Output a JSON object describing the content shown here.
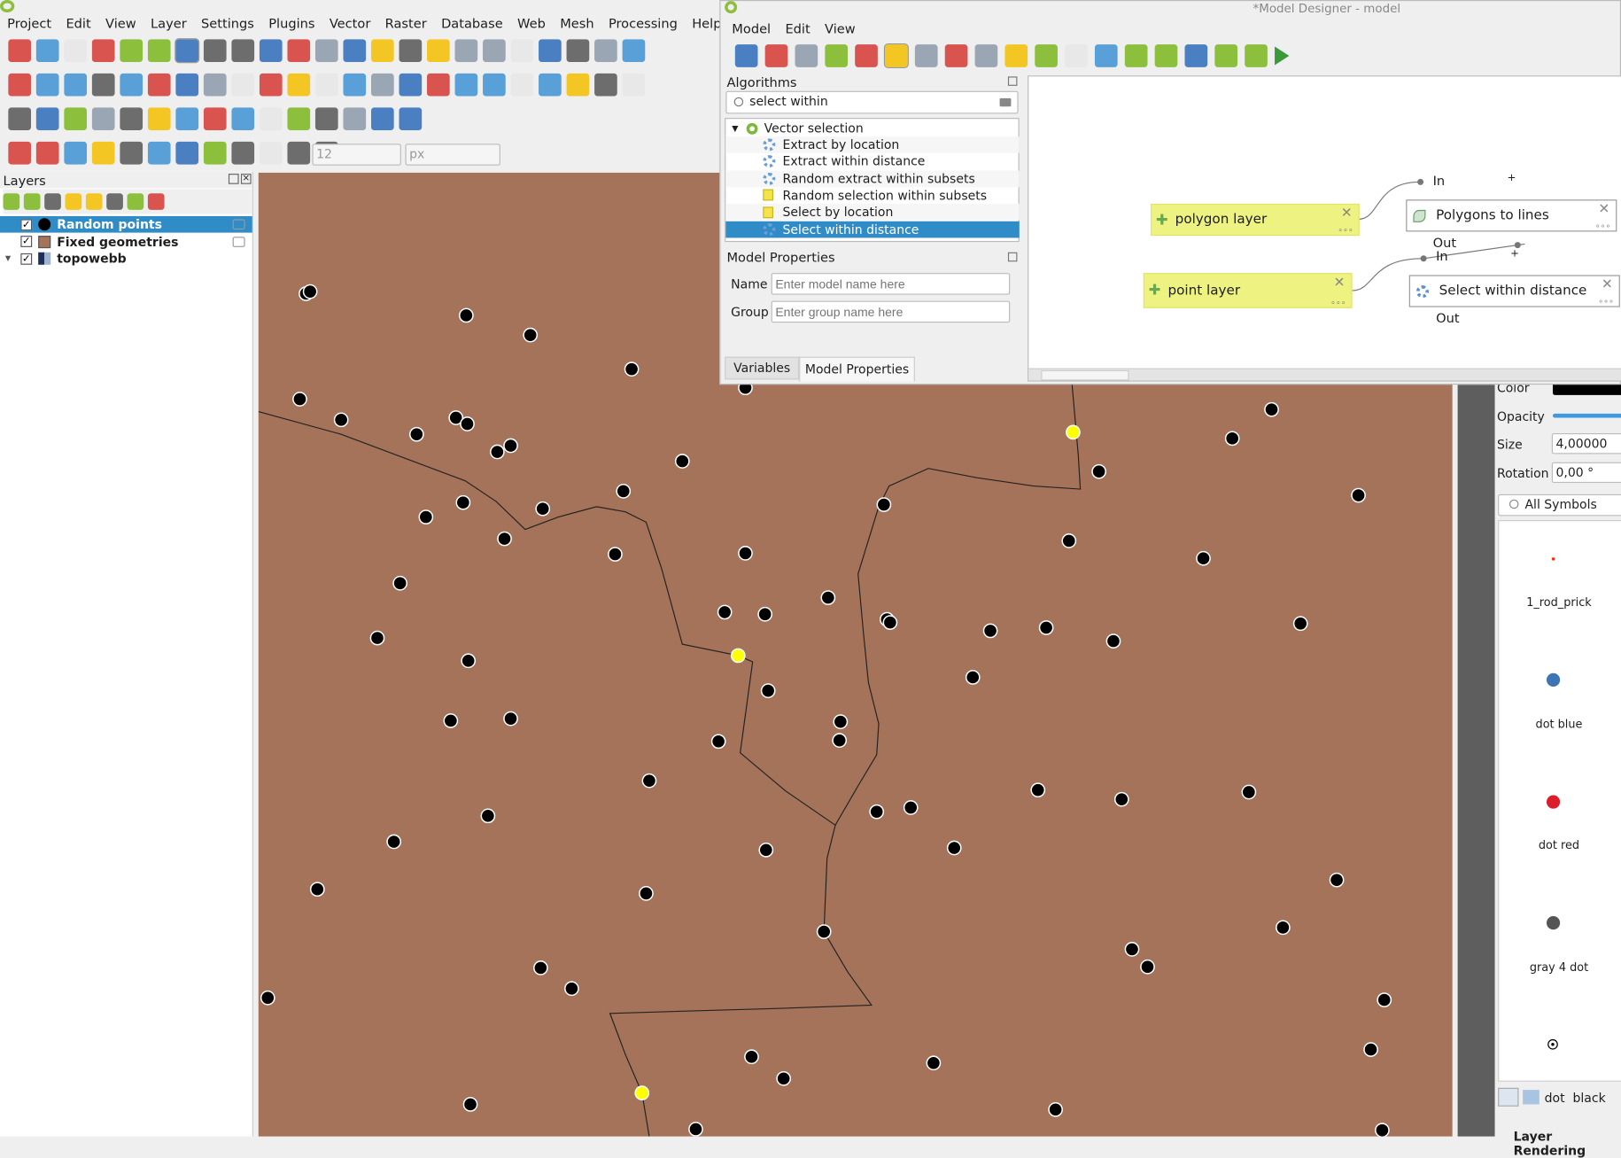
{
  "main": {
    "menu": [
      "Project",
      "Edit",
      "View",
      "Layer",
      "Settings",
      "Plugins",
      "Vector",
      "Raster",
      "Database",
      "Web",
      "Mesh",
      "Processing",
      "Help"
    ],
    "toolbar1": [
      "new-project",
      "open-project",
      "save-project",
      "new-print-layout",
      "layout-manager",
      "style-manager",
      "pan",
      "pan-to-selection",
      "zoom-in",
      "zoom-out",
      "zoom-full",
      "zoom-to-selection",
      "zoom-to-layer",
      "zoom-native",
      "zoom-last",
      "zoom-next",
      "new-map-view",
      "new-3d-view",
      "new-bookmark",
      "show-bookmarks",
      "temporal-controller",
      "refresh",
      "select-features"
    ],
    "toolbar2": [
      "data-source-manager",
      "new-geopackage-layer",
      "new-shapefile-layer",
      "new-spatialite-layer",
      "new-virtual-layer",
      "new-mesh-layer",
      "new-temporary-layer",
      "edits",
      "toggle-editing",
      "save-edits",
      "digitize-point",
      "vertex-tool",
      "modify-attributes",
      "delete-selected",
      "cut",
      "copy",
      "paste",
      "undo",
      "redo",
      "label-tool",
      "diagram-tool",
      "pin-labels",
      "highlight-labels"
    ],
    "toolbar3": [
      "measure",
      "add-ring",
      "add-part",
      "fill-ring",
      "delete-ring",
      "delete-part",
      "reshape",
      "offset-curve",
      "split",
      "merge",
      "merge-attributes",
      "rotate-point",
      "simplify",
      "reverse-line",
      "trim-extend"
    ],
    "toolbar4": [
      "add-circular-string",
      "add-circle",
      "add-ellipse",
      "add-rectangle",
      "add-polygon",
      "snapping",
      "topological-editing",
      "snap-vertex",
      "tracing",
      "self-snapping",
      "avoid-overlap",
      "intersection"
    ],
    "snap_tolerance": "12",
    "snap_unit": "px",
    "layers_panel": {
      "title": "Layers",
      "tools": [
        "open-layer-styling",
        "add-group",
        "manage-themes",
        "filter-legend",
        "filter-by-expression",
        "expand-all",
        "collapse-all",
        "remove-layer"
      ],
      "items": [
        {
          "label": "Random points",
          "checked": true,
          "selected": true,
          "symbol": "black-dot"
        },
        {
          "label": "Fixed geometries",
          "checked": true,
          "selected": false,
          "symbol": "brown-fill"
        },
        {
          "label": "topowebb",
          "checked": true,
          "selected": false,
          "symbol": "raster"
        }
      ]
    },
    "map": {
      "fill_color": "#a57359",
      "point_color": "#000000",
      "selected_point_color": "#ffff00"
    },
    "styling": {
      "color_label": "Color",
      "opacity_label": "Opacity",
      "size_label": "Size",
      "size_value": "4,00000",
      "rotation_label": "Rotation",
      "rotation_value": "0,00 °",
      "search_placeholder": "All Symbols",
      "symbols": [
        {
          "label": "1_rod_prick",
          "color": "#ff2a00"
        },
        {
          "label": "dot blue",
          "color": "#3d74b4"
        },
        {
          "label": "dot red",
          "color": "#db1e2a"
        },
        {
          "label": "gray 4 dot",
          "color": "#555555"
        },
        {
          "label": "",
          "color": "#000000"
        }
      ],
      "selected_symbol": "dot  black",
      "section": "Layer Rendering"
    }
  },
  "designer": {
    "title": "*Model Designer - model",
    "menu": [
      "Model",
      "Edit",
      "View"
    ],
    "toolbar": [
      "new-model",
      "open-model",
      "save-model",
      "save-as",
      "save-in-project",
      "pan",
      "select",
      "undo",
      "redo",
      "zoom-in",
      "zoom-out",
      "zoom-actual",
      "zoom-full",
      "export-python",
      "export-image",
      "export-pdf",
      "export-svg",
      "edit-help",
      "run-model"
    ],
    "algorithms": {
      "title": "Algorithms",
      "search": "select within",
      "group": "Vector selection",
      "items": [
        {
          "label": "Extract by location",
          "icon": "gear"
        },
        {
          "label": "Extract within distance",
          "icon": "gear"
        },
        {
          "label": "Random extract within subsets",
          "icon": "gear"
        },
        {
          "label": "Random selection within subsets",
          "icon": "selection"
        },
        {
          "label": "Select by location",
          "icon": "selection"
        },
        {
          "label": "Select within distance",
          "icon": "gear",
          "selected": true
        }
      ]
    },
    "properties": {
      "title": "Model Properties",
      "name_label": "Name",
      "name_placeholder": "Enter model name here",
      "group_label": "Group",
      "group_placeholder": "Enter group name here"
    },
    "tabs": [
      "Variables",
      "Model Properties"
    ],
    "active_tab": "Model Properties",
    "nodes": {
      "inputs": [
        "polygon layer",
        "point layer"
      ],
      "algs": [
        "Polygons to lines",
        "Select within distance"
      ],
      "in_label": "In",
      "out_label": "Out"
    }
  }
}
